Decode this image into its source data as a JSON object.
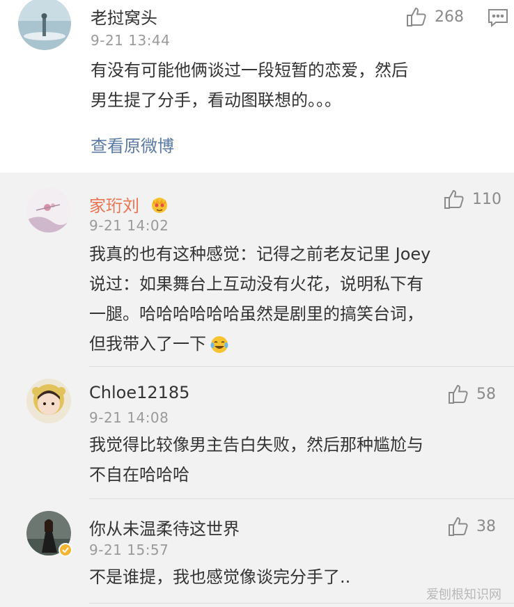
{
  "main_comment": {
    "username": "老挝窝头",
    "time": "9-21 13:44",
    "likes": "268",
    "text_lines": [
      "有没有可能他俩谈过一段短暂的恋爱，然后",
      "男生提了分手，看动图联想的。。。"
    ],
    "view_original": "查看原微博"
  },
  "replies": [
    {
      "username": "家珩刘",
      "time": "9-21 14:02",
      "likes": "110",
      "text_lines": [
        "我真的也有这种感觉：记得之前老友记里 Joey",
        "说过：如果舞台上互动没有火花，说明私下有",
        "一腿。哈哈哈哈哈哈虽然是剧里的搞笑台词，",
        "但我带入了一下"
      ]
    },
    {
      "username": "Chloe12185",
      "time": "9-21 14:08",
      "likes": "58",
      "text_lines": [
        "我觉得比较像男主告白失败，然后那种尴尬与",
        "不自在哈哈哈"
      ]
    },
    {
      "username": "你从未温柔待这世界",
      "time": "9-21 15:57",
      "likes": "38",
      "text_lines": [
        "不是谁提，我也感觉像谈完分手了.."
      ]
    }
  ],
  "watermark": "爱刨根知识网",
  "colors": {
    "accent_name": "#eb7350",
    "link": "#5a7aa3",
    "reply_bg": "#f2f2f2"
  }
}
